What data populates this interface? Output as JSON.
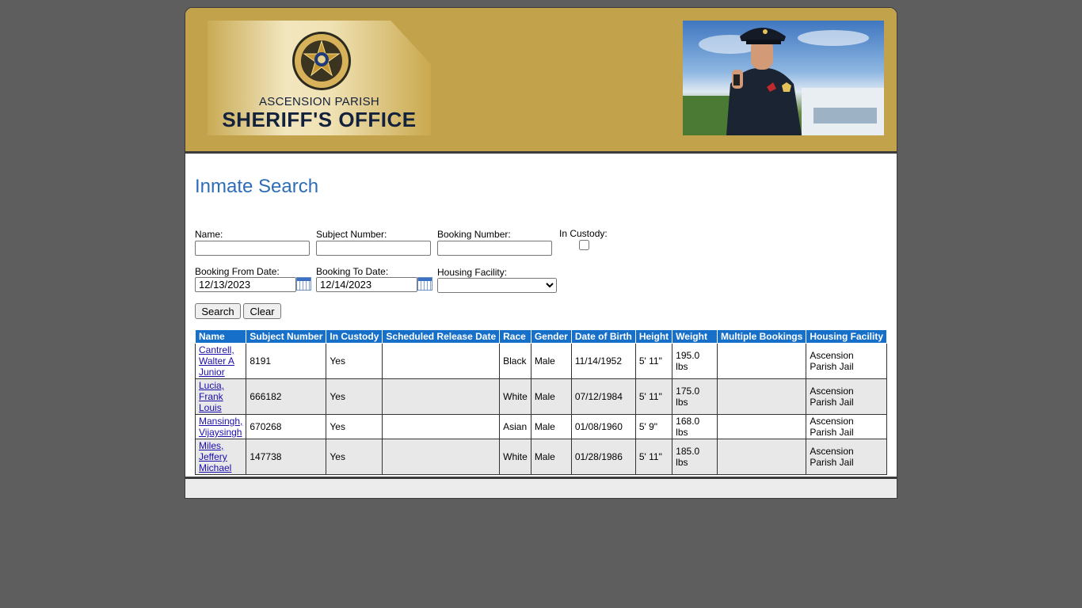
{
  "header": {
    "agency_sub": "ASCENSION PARISH",
    "agency_main": "SHERIFF'S OFFICE",
    "seal_icon": "sheriff-star-seal-icon",
    "photo": "police-officer-photo"
  },
  "page": {
    "title": "Inmate Search"
  },
  "form": {
    "name_label": "Name:",
    "name_value": "",
    "subject_label": "Subject Number:",
    "subject_value": "",
    "booking_label": "Booking Number:",
    "booking_value": "",
    "custody_label": "In Custody:",
    "custody_checked": false,
    "from_label": "Booking From Date:",
    "from_value": "12/13/2023",
    "to_label": "Booking To Date:",
    "to_value": "12/14/2023",
    "housing_label": "Housing Facility:",
    "housing_value": "",
    "search_label": "Search",
    "clear_label": "Clear"
  },
  "table": {
    "headers": [
      "Name",
      "Subject Number",
      "In Custody",
      "Scheduled Release Date",
      "Race",
      "Gender",
      "Date of Birth",
      "Height",
      "Weight",
      "Multiple Bookings",
      "Housing Facility"
    ],
    "rows": [
      {
        "name_lines": [
          "Cantrell,",
          "Walter A",
          "Junior"
        ],
        "subject": "8191",
        "custody": "Yes",
        "release": "",
        "race": "Black",
        "gender": "Male",
        "dob": "11/14/1952",
        "height": "5' 11\"",
        "weight": "195.0 lbs",
        "multiple": "",
        "facility_lines": [
          "Ascension",
          "Parish Jail"
        ]
      },
      {
        "name_lines": [
          "Lucia,",
          "Frank",
          "Louis"
        ],
        "subject": "666182",
        "custody": "Yes",
        "release": "",
        "race": "White",
        "gender": "Male",
        "dob": "07/12/1984",
        "height": "5' 11\"",
        "weight": "175.0 lbs",
        "multiple": "",
        "facility_lines": [
          "Ascension",
          "Parish Jail"
        ]
      },
      {
        "name_lines": [
          "Mansingh,",
          "Vijaysingh"
        ],
        "subject": "670268",
        "custody": "Yes",
        "release": "",
        "race": "Asian",
        "gender": "Male",
        "dob": "01/08/1960",
        "height": "5' 9\"",
        "weight": "168.0 lbs",
        "multiple": "",
        "facility_lines": [
          "Ascension",
          "Parish Jail"
        ]
      },
      {
        "name_lines": [
          "Miles,",
          "Jeffery",
          "Michael"
        ],
        "subject": "147738",
        "custody": "Yes",
        "release": "",
        "race": "White",
        "gender": "Male",
        "dob": "01/28/1986",
        "height": "5' 11\"",
        "weight": "185.0 lbs",
        "multiple": "",
        "facility_lines": [
          "Ascension",
          "Parish Jail"
        ]
      }
    ]
  },
  "colors": {
    "header_gold": "#c2a24a",
    "title_blue": "#2d6db5",
    "table_header_blue": "#1670c9",
    "page_background": "#5e5e5e"
  }
}
